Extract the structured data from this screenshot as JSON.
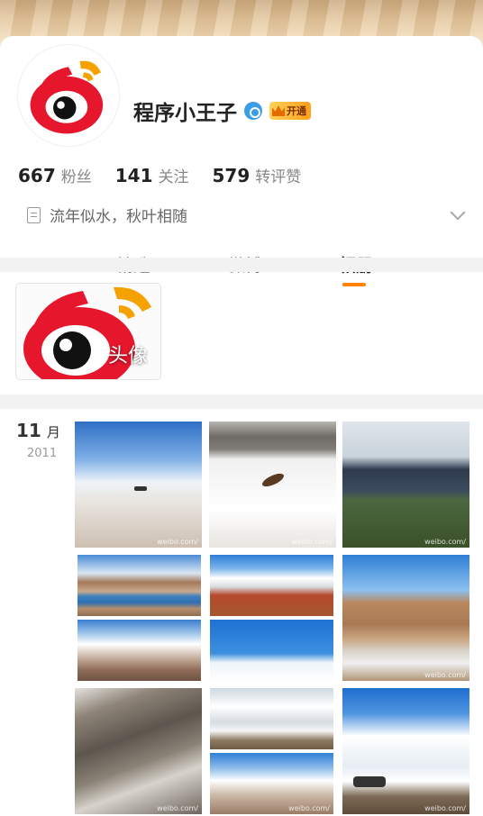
{
  "profile": {
    "username": "程序小王子",
    "gender_icon": "male-verified-icon",
    "vip_label": "开通",
    "stats": [
      {
        "num": "667",
        "label": "粉丝"
      },
      {
        "num": "141",
        "label": "关注"
      },
      {
        "num": "579",
        "label": "转评赞"
      }
    ],
    "bio": "流年似水，秋叶相随"
  },
  "tabs": [
    {
      "label": "精选"
    },
    {
      "label": "微博"
    },
    {
      "label": "相册"
    }
  ],
  "album": {
    "label": "头像"
  },
  "timeline": {
    "month": "11",
    "month_unit": "月",
    "year": "2011"
  },
  "photos": {
    "watermark": "weibo.com/"
  },
  "colors": {
    "accent": "#ff8200",
    "weibo_red": "#e6162d",
    "verify_blue": "#3a9ee6"
  }
}
